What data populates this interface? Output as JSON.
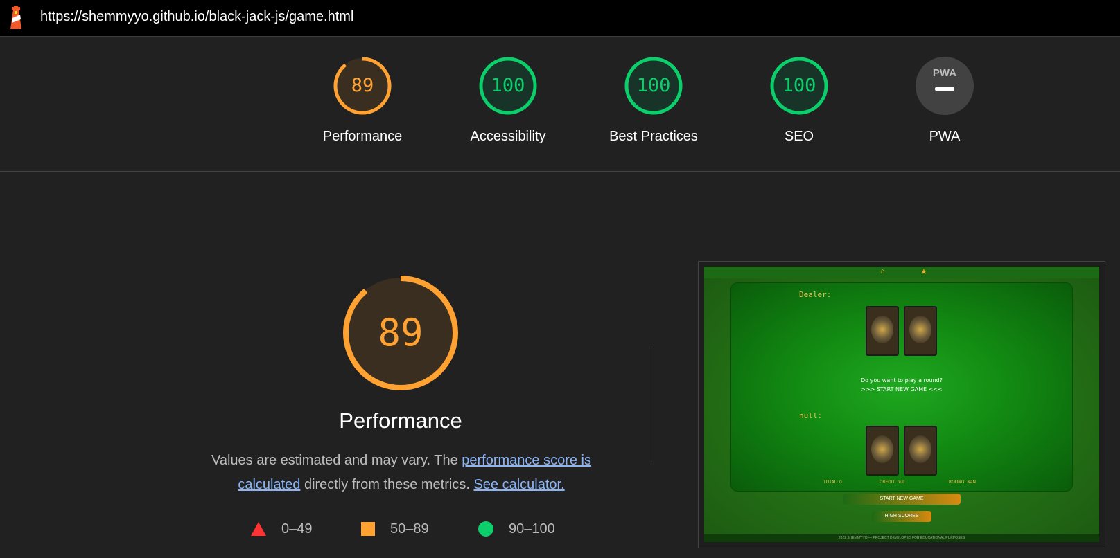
{
  "url": "https://shemmyyo.github.io/black-jack-js/game.html",
  "colors": {
    "orange": "#ffa232",
    "green": "#0cce6b",
    "red": "#ff3333",
    "grey": "#ffffff"
  },
  "gauges": [
    {
      "score": "89",
      "label": "Performance",
      "fraction": 0.89
    },
    {
      "score": "100",
      "label": "Accessibility",
      "fraction": 1.0
    },
    {
      "score": "100",
      "label": "Best Practices",
      "fraction": 1.0
    },
    {
      "score": "100",
      "label": "SEO",
      "fraction": 1.0
    },
    {
      "score": "",
      "label": "PWA",
      "badge": "PWA"
    }
  ],
  "main": {
    "score": "89",
    "fraction": 0.89,
    "title": "Performance",
    "desc_prefix": "Values are estimated and may vary. The ",
    "link1": "performance score is calculated",
    "desc_mid": " directly from these metrics. ",
    "link2": "See calculator."
  },
  "legend": [
    {
      "icon": "triangle-icon",
      "range": "0–49"
    },
    {
      "icon": "square-icon",
      "range": "50–89"
    },
    {
      "icon": "circle-icon",
      "range": "90–100"
    }
  ],
  "screenshot": {
    "dealer": "Dealer:",
    "player": "null:",
    "question": "Do you want to play a round?",
    "start_prompt": ">>> START NEW GAME <<<",
    "total": "TOTAL: 0",
    "credit": "CREDIT: null",
    "round": "ROUND: NaN",
    "btn_new": "START NEW GAME",
    "btn_scores": "HIGH SCORES",
    "footer": "2022 SHEMMYYO — PROJECT DEVELOPED FOR EDUCATIONAL PURPOSES"
  }
}
